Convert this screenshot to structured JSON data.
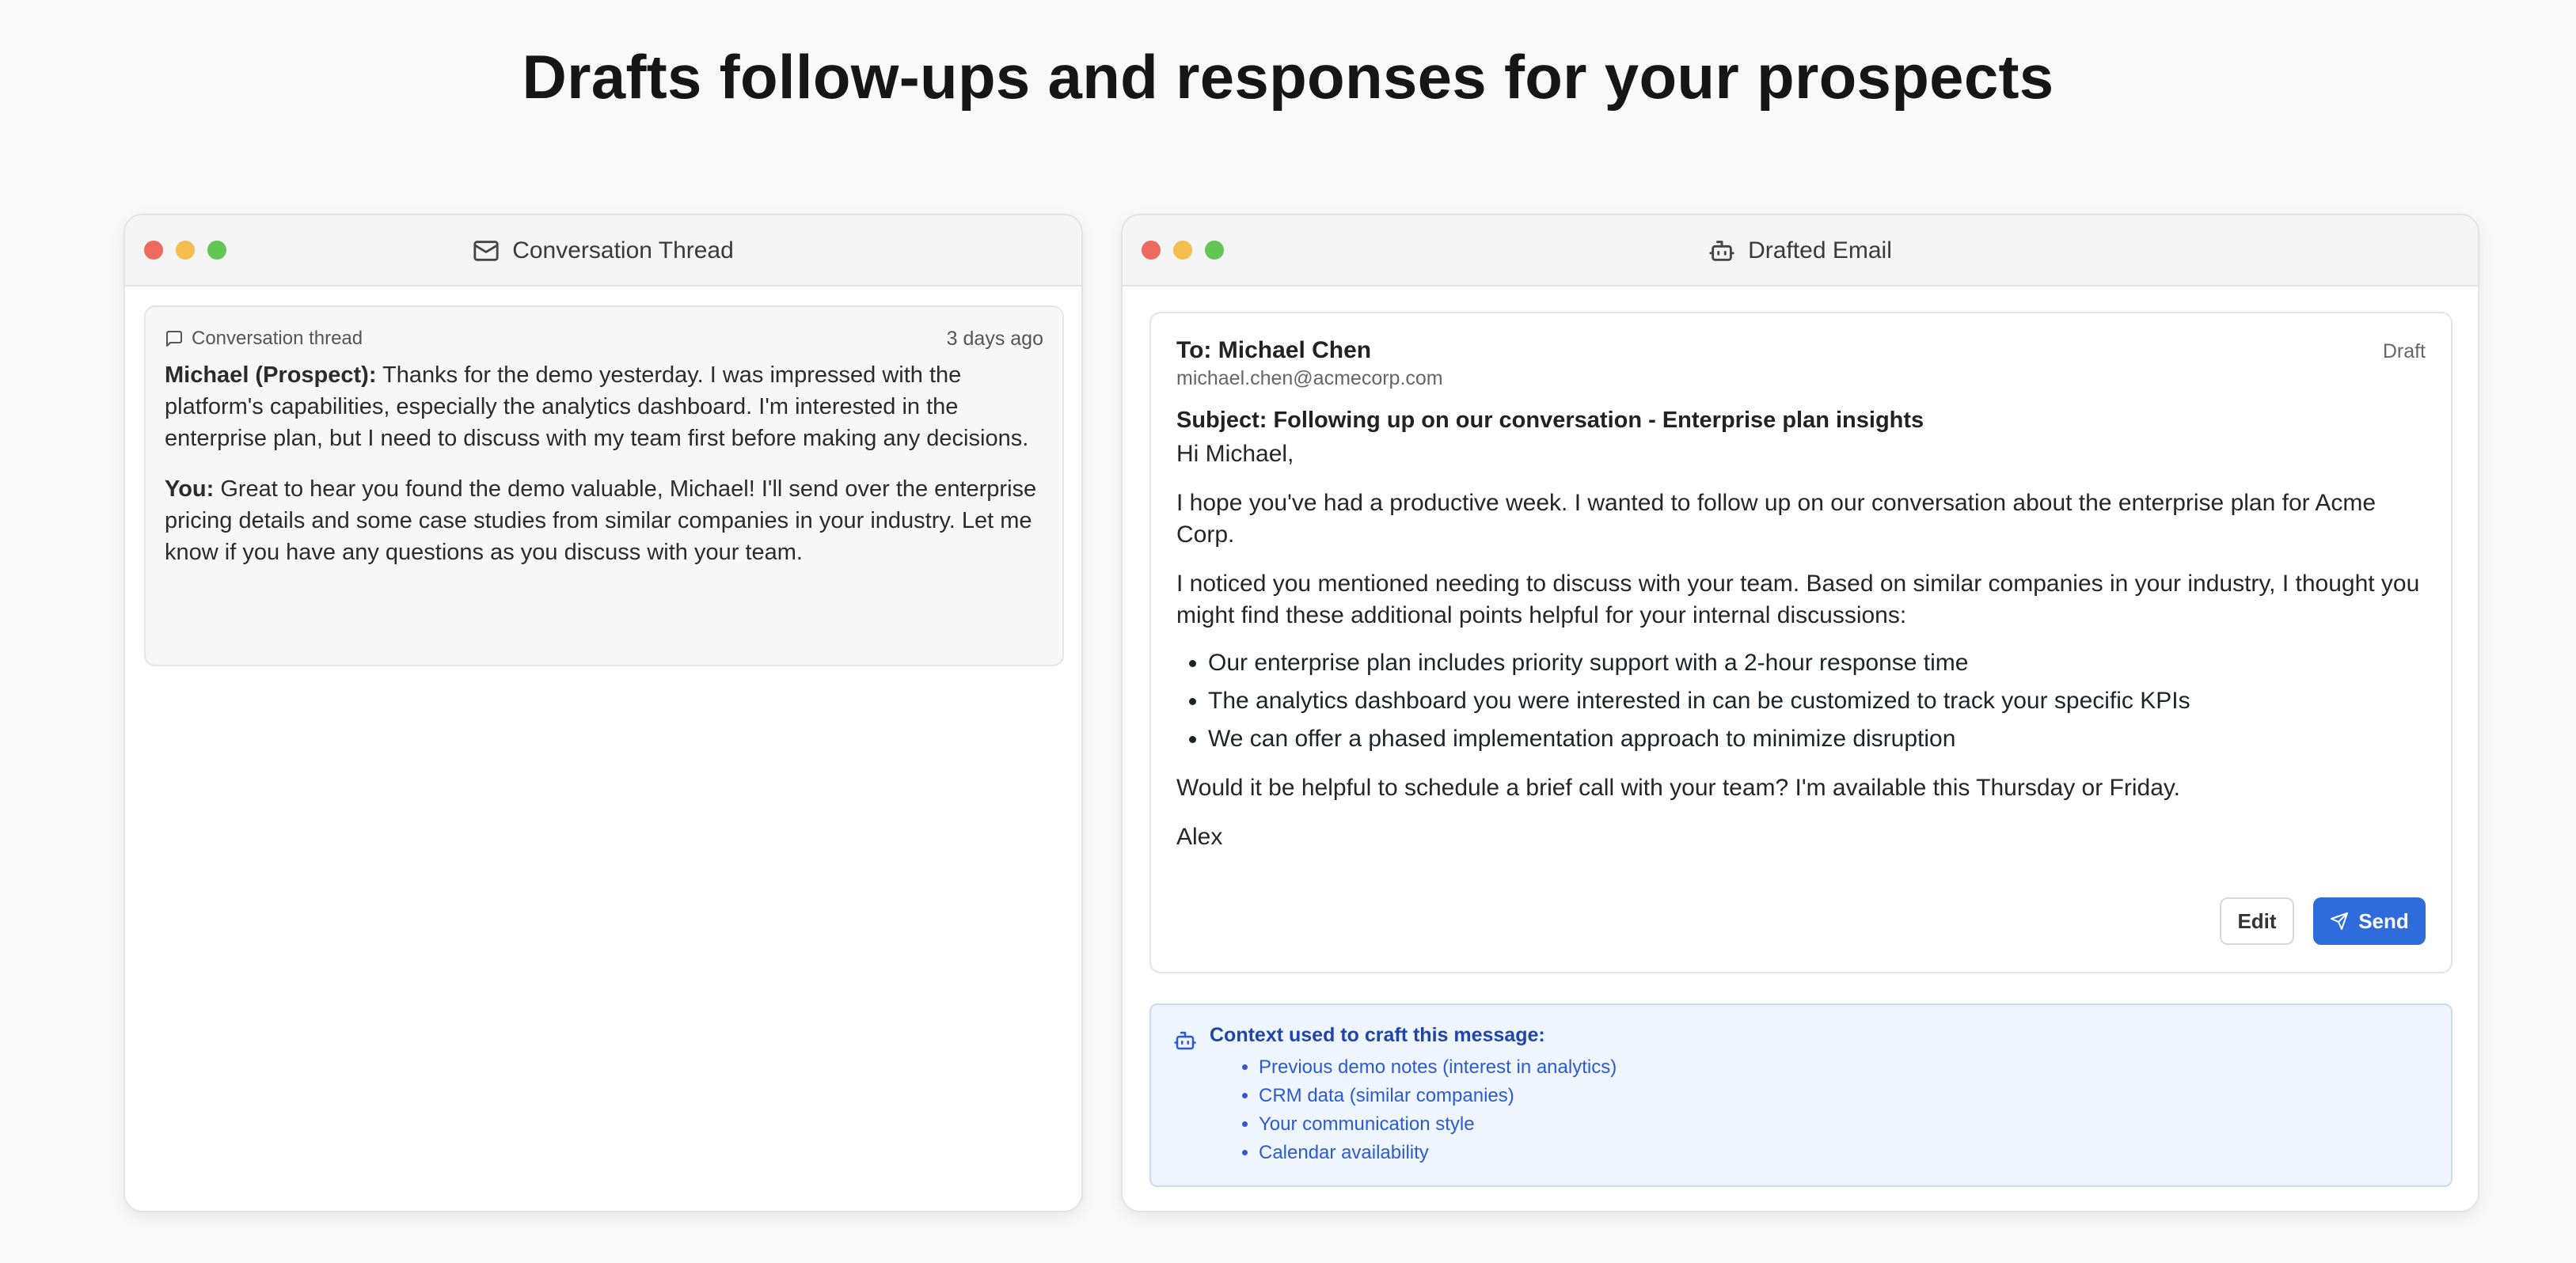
{
  "headline": "Drafts follow-ups and responses for your prospects",
  "left_window": {
    "title": "Conversation Thread",
    "thread_label": "Conversation thread",
    "timestamp": "3 days ago",
    "messages": [
      {
        "sender": "Michael (Prospect):",
        "text": " Thanks for the demo yesterday. I was impressed with the platform's capabilities, especially the analytics dashboard. I'm interested in the enterprise plan, but I need to discuss with my team first before making any decisions."
      },
      {
        "sender": "You:",
        "text": " Great to hear you found the demo valuable, Michael! I'll send over the enterprise pricing details and some case studies from similar companies in your industry. Let me know if you have any questions as you discuss with your team."
      }
    ]
  },
  "right_window": {
    "title": "Drafted Email",
    "email": {
      "to": "To: Michael Chen",
      "status": "Draft",
      "address": "michael.chen@acmecorp.com",
      "subject": "Subject: Following up on our conversation - Enterprise plan insights",
      "greeting": "Hi Michael,",
      "para1": "I hope you've had a productive week. I wanted to follow up on our conversation about the enterprise plan for Acme Corp.",
      "para2": "I noticed you mentioned needing to discuss with your team. Based on similar companies in your industry, I thought you might find these additional points helpful for your internal discussions:",
      "bullets": [
        "Our enterprise plan includes priority support with a 2-hour response time",
        "The analytics dashboard you were interested in can be customized to track your specific KPIs",
        "We can offer a phased implementation approach to minimize disruption"
      ],
      "para3": "Would it be helpful to schedule a brief call with your team? I'm available this Thursday or Friday.",
      "signature": "Alex",
      "edit_label": "Edit",
      "send_label": "Send"
    },
    "context": {
      "title": "Context used to craft this message:",
      "items": [
        "Previous demo notes (interest in analytics)",
        "CRM data (similar companies)",
        "Your communication style",
        "Calendar availability"
      ]
    }
  },
  "colors": {
    "accent": "#2e6bdb",
    "context_bg": "#eef5fe",
    "context_text": "#2c5bd1",
    "traffic_red": "#ec6b5e",
    "traffic_yellow": "#f4be4f",
    "traffic_green": "#62c554"
  },
  "icons": {
    "left_title": "mail-icon",
    "thread": "message-square-icon",
    "right_title": "bot-icon",
    "send": "send-icon",
    "context": "bot-icon"
  }
}
